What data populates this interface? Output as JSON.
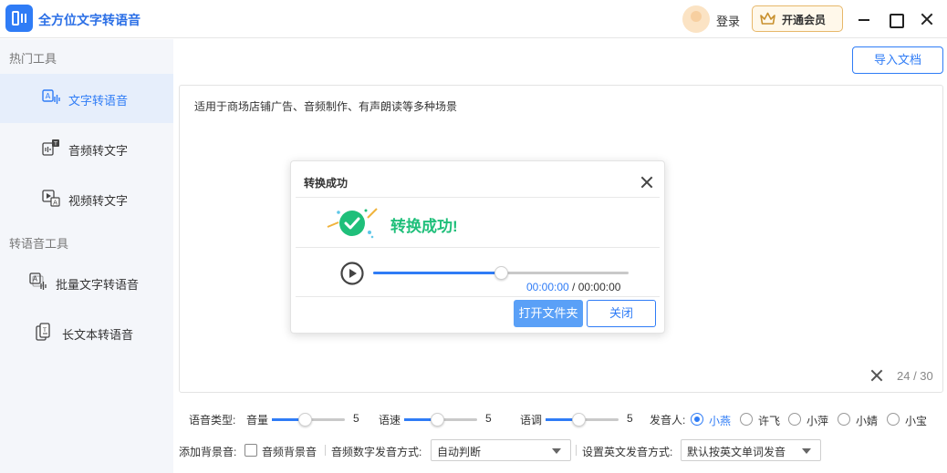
{
  "app": {
    "title": "全方位文字转语音"
  },
  "header": {
    "login_label": "登录",
    "vip_label": "开通会员"
  },
  "sidebar": {
    "section_hot": "热门工具",
    "section_tts": "转语音工具",
    "items": [
      {
        "label": "文字转语音",
        "icon": "text-to-speech-icon",
        "active": true
      },
      {
        "label": "音频转文字",
        "icon": "audio-to-text-icon"
      },
      {
        "label": "视频转文字",
        "icon": "video-to-text-icon"
      },
      {
        "label": "批量文字转语音",
        "icon": "batch-tts-icon"
      },
      {
        "label": "长文本转语音",
        "icon": "long-text-tts-icon"
      }
    ]
  },
  "toolbar": {
    "import_label": "导入文档"
  },
  "editor": {
    "text": "适用于商场店铺广告、音频制作、有声朗读等多种场景",
    "count": "24 / 30"
  },
  "dialog": {
    "title": "转换成功",
    "message": "转换成功!",
    "current_time": "00:00:00",
    "separator": " / ",
    "total_time": "00:00:00",
    "progress_fraction": 0.5,
    "open_folder_label": "打开文件夹",
    "close_label": "关闭"
  },
  "settings": {
    "voice_type_label": "语音类型:",
    "volume": {
      "label": "音量",
      "value": "5"
    },
    "speed": {
      "label": "语速",
      "value": "5"
    },
    "pitch": {
      "label": "语调",
      "value": "5"
    },
    "speaker_label": "发音人:",
    "speakers": [
      {
        "label": "小燕",
        "checked": true
      },
      {
        "label": "许飞"
      },
      {
        "label": "小萍"
      },
      {
        "label": "小婧"
      },
      {
        "label": "小宝"
      }
    ],
    "bg_music_label": "添加背景音:",
    "bg_music_checkbox_label": "音频背景音",
    "number_mode_label": "音频数字发音方式:",
    "number_mode_value": "自动判断",
    "english_mode_label": "设置英文发音方式:",
    "english_mode_value": "默认按英文单词发音"
  },
  "colors": {
    "accent": "#2f7cf6",
    "success": "#1fbf7a",
    "vip_border": "#e7b769"
  }
}
